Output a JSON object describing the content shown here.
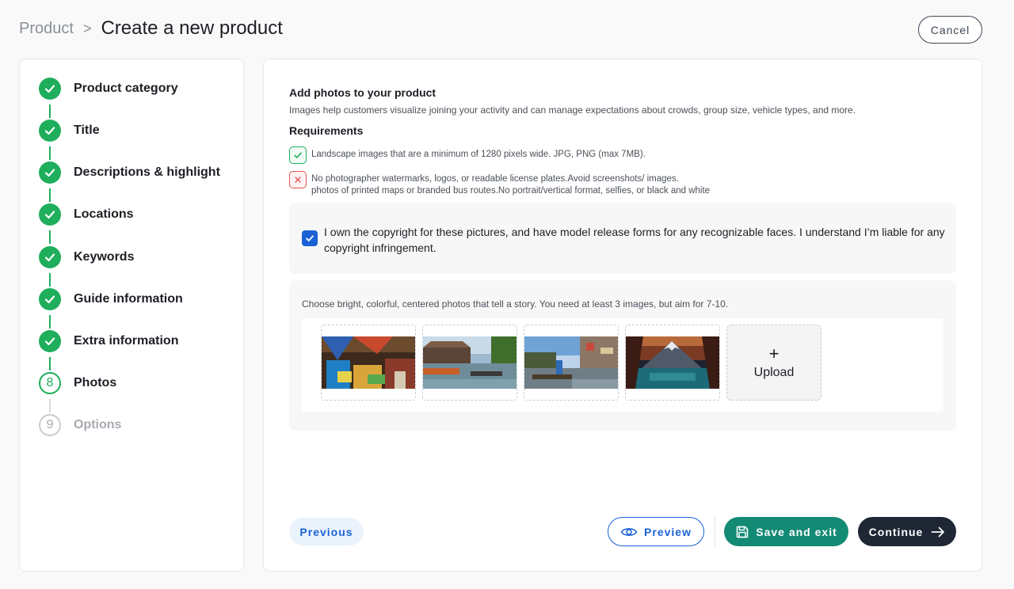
{
  "header": {
    "breadcrumb_root": "Product",
    "breadcrumb_sep": ">",
    "title": "Create a new product",
    "cancel_label": "Cancel"
  },
  "steps": [
    {
      "label": "Product category",
      "state": "done"
    },
    {
      "label": "Title",
      "state": "done"
    },
    {
      "label": "Descriptions & highlight",
      "state": "done"
    },
    {
      "label": "Locations",
      "state": "done"
    },
    {
      "label": "Keywords",
      "state": "done"
    },
    {
      "label": "Guide information",
      "state": "done"
    },
    {
      "label": "Extra information",
      "state": "done"
    },
    {
      "label": "Photos",
      "state": "current",
      "number": "8"
    },
    {
      "label": "Options",
      "state": "todo",
      "number": "9"
    }
  ],
  "photos_section": {
    "title": "Add photos to your product",
    "description": "Images help customers visualize joining your activity and can manage expectations about crowds, group size, vehicle types, and more.",
    "requirements_title": "Requirements",
    "requirement_ok": "Landscape images that are a minimum of 1280 pixels wide. JPG, PNG (max 7MB).",
    "requirement_bad_line1": "No photographer watermarks, logos, or readable license plates.Avoid screenshots/ images.",
    "requirement_bad_line2": "photos of printed maps or branded bus routes.No portrait/vertical format, selfies, or black and white",
    "consent_text": "I own the copyright for these pictures, and have model release forms for any recognizable faces. I understand I’m liable for any copyright infringement.",
    "consent_checked": true,
    "photos_hint": "Choose bright, colorful, centered photos that tell a story. You need at least 3 images, but aim for 7-10.",
    "upload_plus": "+",
    "upload_label": "Upload"
  },
  "footer": {
    "previous_label": "Previous",
    "preview_label": "Preview",
    "save_label": "Save and exit",
    "continue_label": "Continue"
  },
  "colors": {
    "done_green": "#1fae5c",
    "primary_blue": "#1a62d6",
    "save_teal": "#138a74",
    "continue_dark": "#1e2733",
    "error_red": "#e05454"
  }
}
